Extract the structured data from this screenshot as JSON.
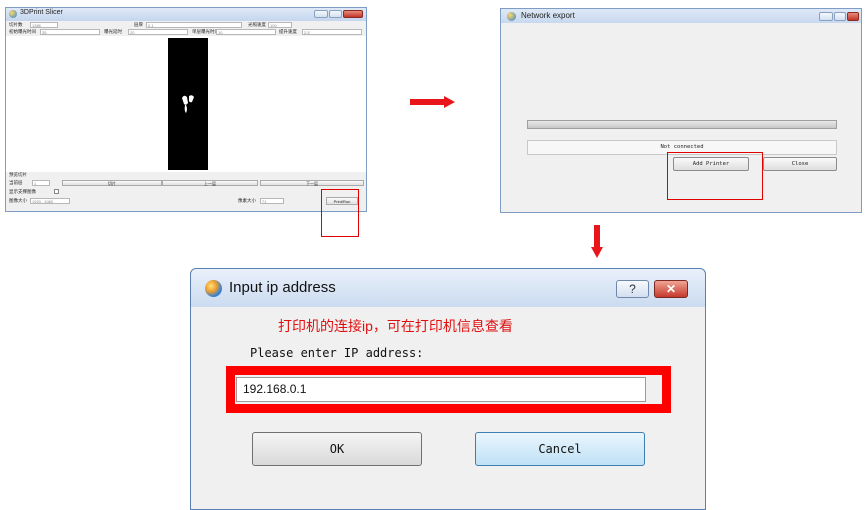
{
  "slicer_window": {
    "title": "3DPrint Slicer",
    "labels": {
      "slice_count": "切片数",
      "color": "层厚",
      "platform": "光照速度",
      "bottom_exposure": "初始曝光时间",
      "layer_exposure": "曝光延时",
      "exposure_time": "单层曝光时间",
      "delay": "提升速度",
      "slice_heading": "预览切片",
      "current_layer": "当前层",
      "show_support": "显示支撑图像",
      "image_size": "图像大小",
      "pixel_size": "像素大小"
    },
    "values": {
      "slice_count": "1386",
      "color": "0.1",
      "platform": "100",
      "bottom_exposure": "35",
      "layer_exposure": "20",
      "exposure_time": "10",
      "delay": "2.5",
      "current_layer": "1",
      "image_size": "1920 , 1080",
      "pixel_size": "71"
    },
    "buttons": {
      "slice": "切片",
      "prev": "上一层",
      "next": "下一层",
      "print": "Print/Run"
    }
  },
  "network_window": {
    "title": "Network export",
    "status": "Not connected",
    "buttons": {
      "add_printer": "Add Printer",
      "close": "Close"
    }
  },
  "ip_dialog": {
    "title": "Input ip address",
    "note": "打印机的连接ip，可在打印机信息查看",
    "prompt": "Please enter IP address:",
    "ip_value": "192.168.0.1",
    "help_glyph": "?",
    "close_glyph": "✕",
    "buttons": {
      "ok": "OK",
      "cancel": "Cancel"
    }
  },
  "colors": {
    "annotation_red": "#ff0000",
    "arrow_red": "#e8161a",
    "note_red": "#e01010"
  }
}
